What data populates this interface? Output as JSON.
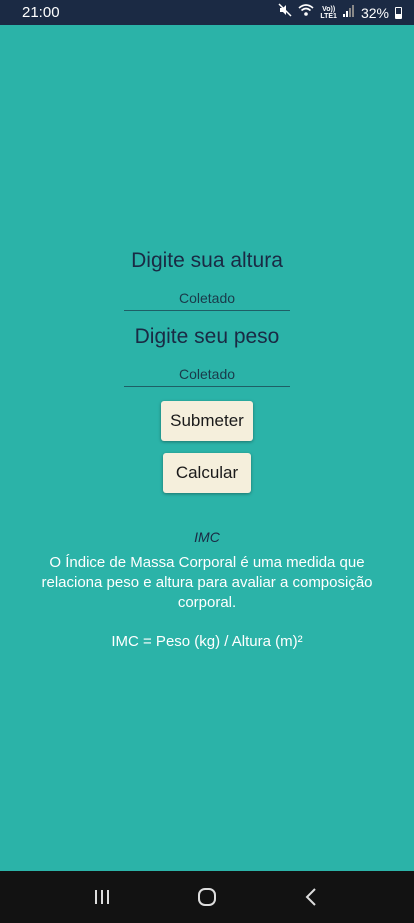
{
  "status_bar": {
    "time": "21:00",
    "network_top": "Vo))",
    "network_bottom": "LTE1",
    "battery": "32%"
  },
  "form": {
    "height_label": "Digite sua altura",
    "height_field": "Coletado",
    "weight_label": "Digite seu peso",
    "weight_field": "Coletado",
    "submit_label": "Submeter",
    "calculate_label": "Calcular"
  },
  "info": {
    "title": "IMC",
    "description": "O Índice de Massa Corporal é uma medida que relaciona peso e altura para avaliar a composição corporal.",
    "formula": "IMC = Peso (kg) / Altura (m)²"
  },
  "colors": {
    "background": "#2bb3a8",
    "status_bar": "#1b2a44",
    "nav_bar": "#121212",
    "button": "#f5efdc"
  },
  "icons": {
    "status": [
      "mute-icon",
      "wifi-icon",
      "signal-icon",
      "battery-icon"
    ],
    "nav": [
      "recent-apps-icon",
      "home-icon",
      "back-icon"
    ]
  }
}
